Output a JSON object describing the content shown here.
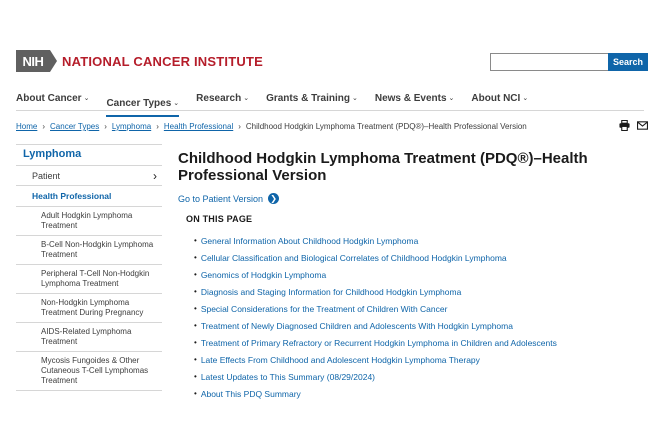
{
  "header": {
    "logo_abbrev": "NIH",
    "logo_name": "NATIONAL CANCER INSTITUTE",
    "search_placeholder": "",
    "search_button": "Search"
  },
  "nav": {
    "items": [
      {
        "label": "About Cancer"
      },
      {
        "label": "Cancer Types"
      },
      {
        "label": "Research"
      },
      {
        "label": "Grants & Training"
      },
      {
        "label": "News & Events"
      },
      {
        "label": "About NCI"
      }
    ],
    "active": "Cancer Types"
  },
  "breadcrumb": {
    "items": [
      "Home",
      "Cancer Types",
      "Lymphoma",
      "Health Professional"
    ],
    "current": "Childhood Hodgkin Lymphoma Treatment (PDQ®)–Health Professional Version"
  },
  "sidebar": {
    "heading": "Lymphoma",
    "patient": "Patient",
    "health_professional": "Health Professional",
    "subitems": [
      {
        "label": "Adult Hodgkin Lymphoma Treatment"
      },
      {
        "label": "B-Cell Non-Hodgkin Lymphoma Treatment"
      },
      {
        "label": "Peripheral T-Cell Non-Hodgkin Lymphoma Treatment"
      },
      {
        "label": "Non-Hodgkin Lymphoma Treatment During Pregnancy"
      },
      {
        "label": "AIDS-Related Lymphoma Treatment"
      },
      {
        "label": "Mycosis Fungoides & Other Cutaneous T-Cell Lymphomas Treatment"
      }
    ]
  },
  "main": {
    "title_line1": "Childhood Hodgkin Lymphoma Treatment (PDQ®)–Health",
    "title_line2": "Professional Version",
    "patient_link": "Go to Patient Version",
    "on_this_page": "ON THIS PAGE",
    "toc": [
      {
        "label": "General Information About Childhood Hodgkin Lymphoma"
      },
      {
        "label": "Cellular Classification and Biological Correlates of Childhood Hodgkin Lymphoma"
      },
      {
        "label": "Genomics of Hodgkin Lymphoma"
      },
      {
        "label": "Diagnosis and Staging Information for Childhood Hodgkin Lymphoma"
      },
      {
        "label": "Special Considerations for the Treatment of Children With Cancer"
      },
      {
        "label": "Treatment of Newly Diagnosed Children and Adolescents With Hodgkin Lymphoma"
      },
      {
        "label": "Treatment of Primary Refractory or Recurrent Hodgkin Lymphoma in Children and Adolescents"
      },
      {
        "label": "Late Effects From Childhood and Adolescent Hodgkin Lymphoma Therapy"
      },
      {
        "label": "Latest Updates to This Summary (08/29/2024)"
      },
      {
        "label": "About This PDQ Summary"
      }
    ]
  },
  "icons": {
    "print": "print-icon",
    "email": "email-icon",
    "dropdown": "chevron-down-icon",
    "arrow": "arrow-right-circle-icon"
  },
  "colors": {
    "brand_red": "#b51d2a",
    "link_blue": "#0f65a9",
    "nih_gray": "#606060"
  }
}
